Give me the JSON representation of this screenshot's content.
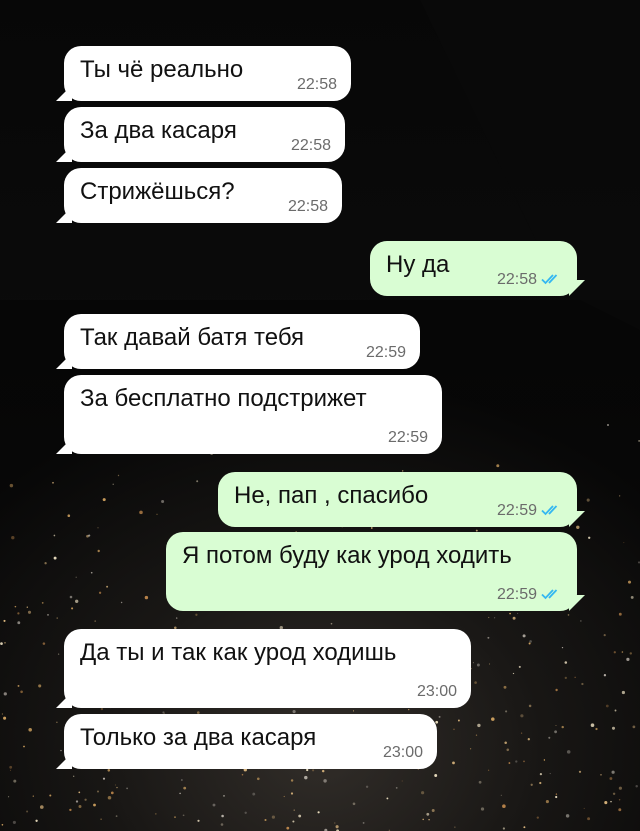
{
  "colors": {
    "incoming_bubble": "#ffffff",
    "outgoing_bubble": "#d9fdd3",
    "time_text": "#6b6b6b",
    "read_ticks": "#34b7f1"
  },
  "messages": [
    {
      "direction": "incoming",
      "text": "Ты чё реально",
      "time": "22:58"
    },
    {
      "direction": "incoming",
      "text": "За два касаря",
      "time": "22:58"
    },
    {
      "direction": "incoming",
      "text": "Стрижёшься?",
      "time": "22:58"
    },
    {
      "direction": "outgoing",
      "text": "Ну да",
      "time": "22:58",
      "status_icon": "read-double-check-icon"
    },
    {
      "direction": "incoming",
      "text": "Так давай батя тебя",
      "time": "22:59"
    },
    {
      "direction": "incoming",
      "text": "За бесплатно подстрижет",
      "time": "22:59"
    },
    {
      "direction": "outgoing",
      "text": "Не, пап , спасибо",
      "time": "22:59",
      "status_icon": "read-double-check-icon"
    },
    {
      "direction": "outgoing",
      "text": "Я потом буду как урод ходить",
      "time": "22:59",
      "status_icon": "read-double-check-icon"
    },
    {
      "direction": "incoming",
      "text": "Да ты и так как урод ходишь",
      "time": "23:00"
    },
    {
      "direction": "incoming",
      "text": "Только за два касаря",
      "time": "23:00"
    }
  ]
}
